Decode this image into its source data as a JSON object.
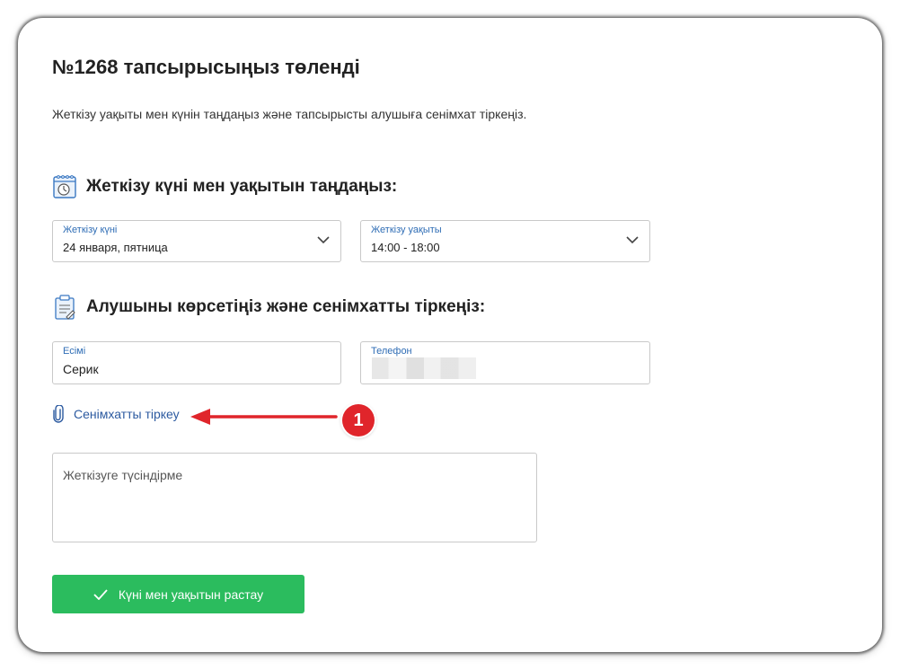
{
  "order": {
    "title": "№1268 тапсырысыңыз төленді",
    "subtitle": "Жеткізу уақыты мен күнін таңдаңыз және тапсырысты алушыға сенімхат тіркеңіз."
  },
  "delivery_section": {
    "heading": "Жеткізу күні мен уақытын таңдаңыз:",
    "icon": "calendar-clock-icon",
    "date_field": {
      "label": "Жеткізу күні",
      "value": "24 января, пятница"
    },
    "time_field": {
      "label": "Жеткізу уақыты",
      "value": "14:00 - 18:00"
    }
  },
  "recipient_section": {
    "heading": "Алушыны көрсетіңіз және сенімхатты тіркеңіз:",
    "icon": "document-clipboard-icon",
    "name_field": {
      "label": "Есімі",
      "value": "Серик"
    },
    "phone_field": {
      "label": "Телефон"
    }
  },
  "attach": {
    "label": "Сенімхатты тіркеу",
    "icon": "paperclip-icon"
  },
  "annotation": {
    "number": "1"
  },
  "comment": {
    "placeholder": "Жеткізуге түсіндірме"
  },
  "confirm_button": {
    "label": "Күні мен уақытын растау"
  },
  "colors": {
    "accent_blue": "#2f6db5",
    "link_blue": "#2c5aa0",
    "button_green": "#2bbc5e",
    "badge_red": "#e0252b"
  }
}
